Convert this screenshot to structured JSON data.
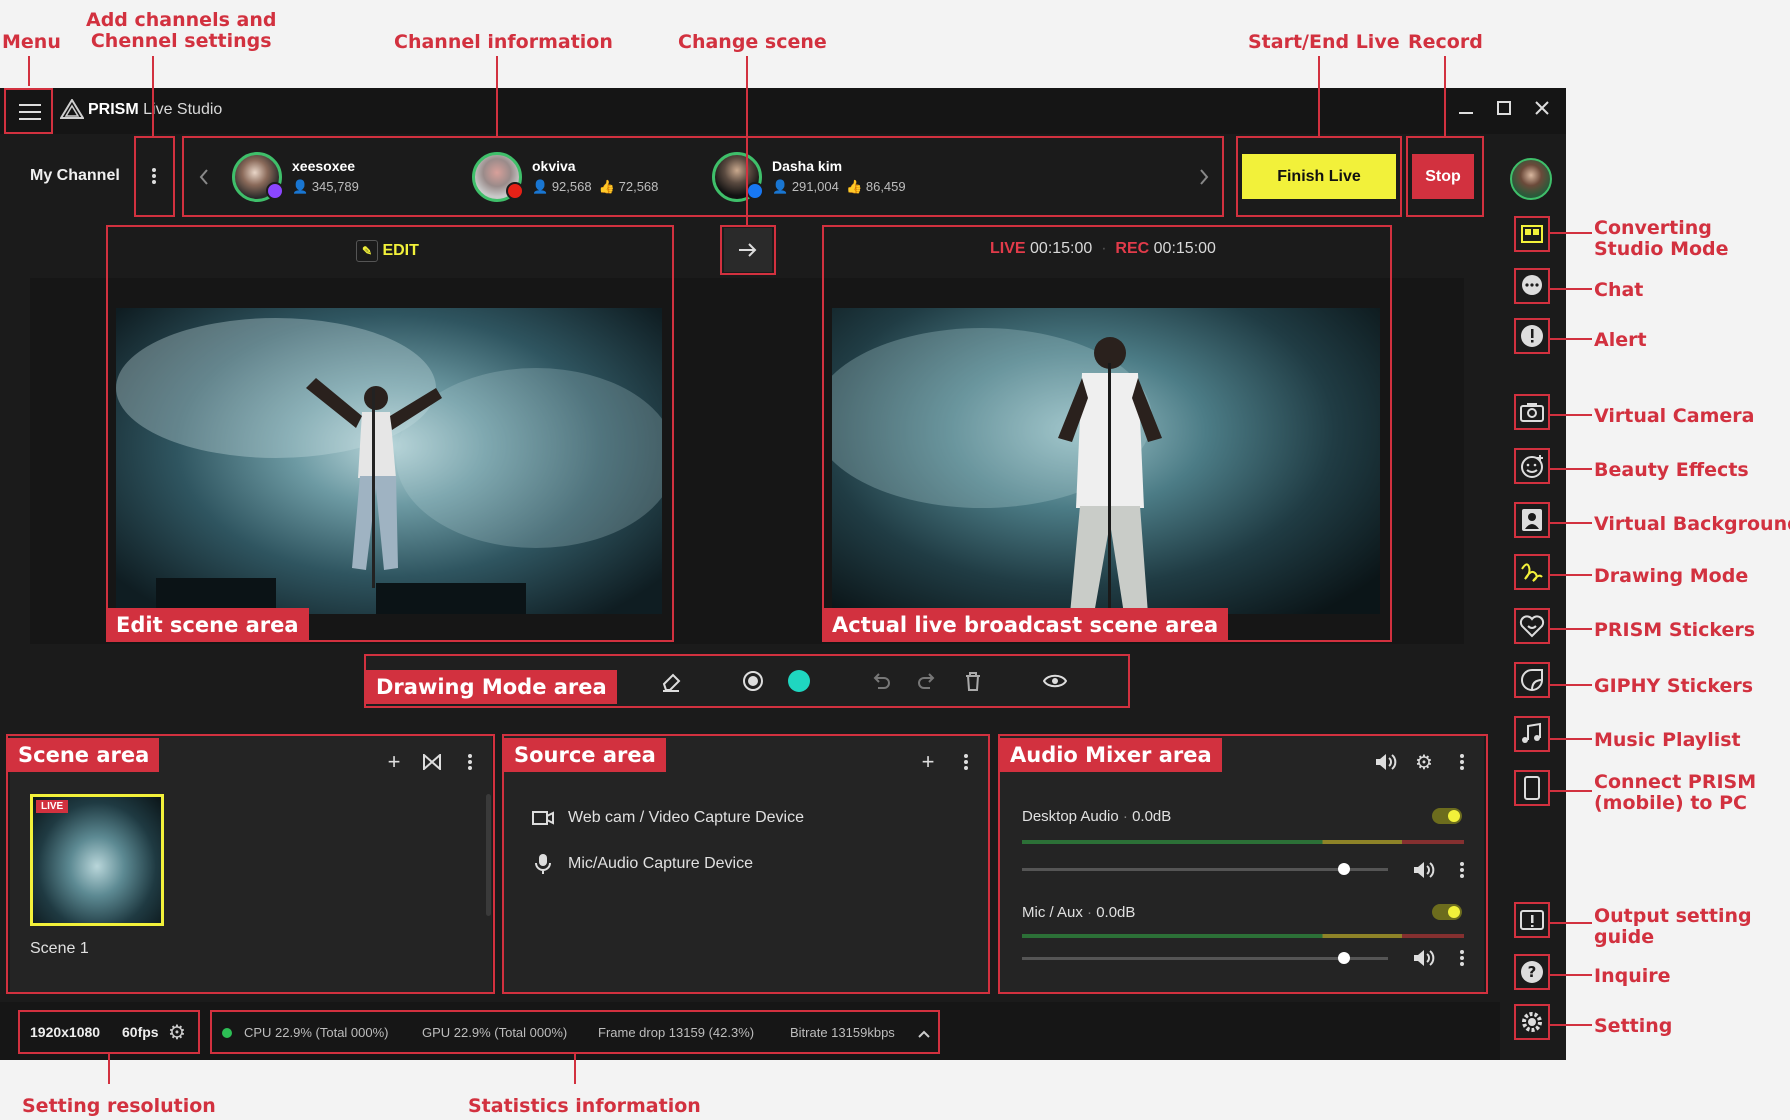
{
  "annotations": {
    "menu": "Menu",
    "add_channels_1": "Add channels and",
    "add_channels_2": "Chennel settings",
    "channel_info": "Channel information",
    "change_scene": "Change scene",
    "start_end_live": "Start/End Live",
    "record": "Record",
    "converting_1": "Converting",
    "converting_2": "Studio Mode",
    "chat": "Chat",
    "alert": "Alert",
    "virtual_camera": "Virtual Camera",
    "beauty": "Beauty Effects",
    "virtual_bg": "Virtual Background",
    "drawing": "Drawing Mode",
    "prism_stickers": "PRISM Stickers",
    "giphy": "GIPHY Stickers",
    "music": "Music Playlist",
    "connect_1": "Connect PRISM",
    "connect_2": "(mobile) to PC",
    "output_1": "Output setting",
    "output_2": "guide",
    "inquire": "Inquire",
    "setting": "Setting",
    "setting_resolution": "Setting resolution",
    "statistics": "Statistics information"
  },
  "area_tags": {
    "edit_scene": "Edit scene area",
    "live_scene": "Actual live broadcast scene area",
    "drawing": "Drawing Mode area",
    "scene": "Scene area",
    "source": "Source area",
    "audio": "Audio Mixer area"
  },
  "app": {
    "title_bold": "PRISM",
    "title_rest": "Live Studio",
    "my_channel": "My Channel"
  },
  "channels": [
    {
      "name": "xeesoxee",
      "viewers": "345,789",
      "likes": ""
    },
    {
      "name": "okviva",
      "viewers": "92,568",
      "likes": "72,568"
    },
    {
      "name": "Dasha kim",
      "viewers": "291,004",
      "likes": "86,459"
    }
  ],
  "buttons": {
    "finish_live": "Finish Live",
    "stop": "Stop"
  },
  "preview": {
    "edit_label": "EDIT",
    "live_label": "LIVE",
    "live_time": "00:15:00",
    "rec_label": "REC",
    "rec_time": "00:15:00"
  },
  "scenes": [
    {
      "name": "Scene 1",
      "badge": "LIVE"
    }
  ],
  "sources": [
    {
      "label": "Web cam / Video Capture Device",
      "icon": "camera-icon"
    },
    {
      "label": "Mic/Audio Capture Device",
      "icon": "mic-icon"
    }
  ],
  "audio": [
    {
      "name": "Desktop Audio",
      "level": "0.0dB",
      "volume": 0.88
    },
    {
      "name": "Mic / Aux",
      "level": "0.0dB",
      "volume": 0.88
    }
  ],
  "status": {
    "resolution": "1920x1080",
    "fps": "60fps",
    "cpu": "CPU 22.9% (Total 000%)",
    "gpu": "GPU 22.9% (Total 000%)",
    "frame_drop": "Frame drop 13159 (42.3%)",
    "bitrate": "Bitrate 13159kbps"
  },
  "colors": {
    "accent_red": "#d2313f",
    "live_yellow": "#f2f13a",
    "brush_teal": "#1fd6c0"
  }
}
